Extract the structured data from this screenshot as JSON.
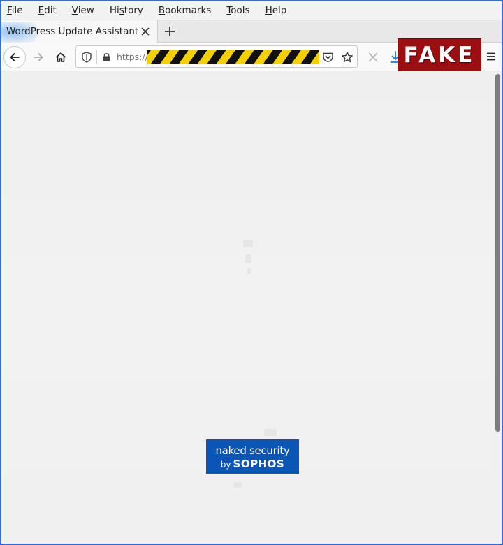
{
  "menubar": {
    "items": [
      {
        "prefix": "",
        "accel": "F",
        "rest": "ile"
      },
      {
        "prefix": "",
        "accel": "E",
        "rest": "dit"
      },
      {
        "prefix": "",
        "accel": "V",
        "rest": "iew"
      },
      {
        "prefix": "Hi",
        "accel": "s",
        "rest": "tory"
      },
      {
        "prefix": "",
        "accel": "B",
        "rest": "ookmarks"
      },
      {
        "prefix": "",
        "accel": "T",
        "rest": "ools"
      },
      {
        "prefix": "",
        "accel": "H",
        "rest": "elp"
      }
    ]
  },
  "tab": {
    "title": "WordPress Update Assistant",
    "close_icon": "close-icon",
    "new_tab_icon": "plus-icon"
  },
  "navbar": {
    "url_prefix": "https://",
    "icons": [
      "back-arrow-icon",
      "forward-arrow-icon",
      "home-icon",
      "shield-icon",
      "lock-icon",
      "pocket-icon",
      "star-icon",
      "stop-icon",
      "download-icon",
      "hamburger-menu-icon"
    ]
  },
  "overlay": {
    "label": "FAKE",
    "color": "#9b0e12"
  },
  "watermark": {
    "line1": "naked security",
    "by": "by",
    "brand": "SOPHOS",
    "color": "#0b55b7"
  },
  "colors": {
    "window_border": "#3a6fc4",
    "page_background": "#f0f0f0",
    "redaction_yellow": "#f5d000",
    "redaction_black": "#111111"
  }
}
